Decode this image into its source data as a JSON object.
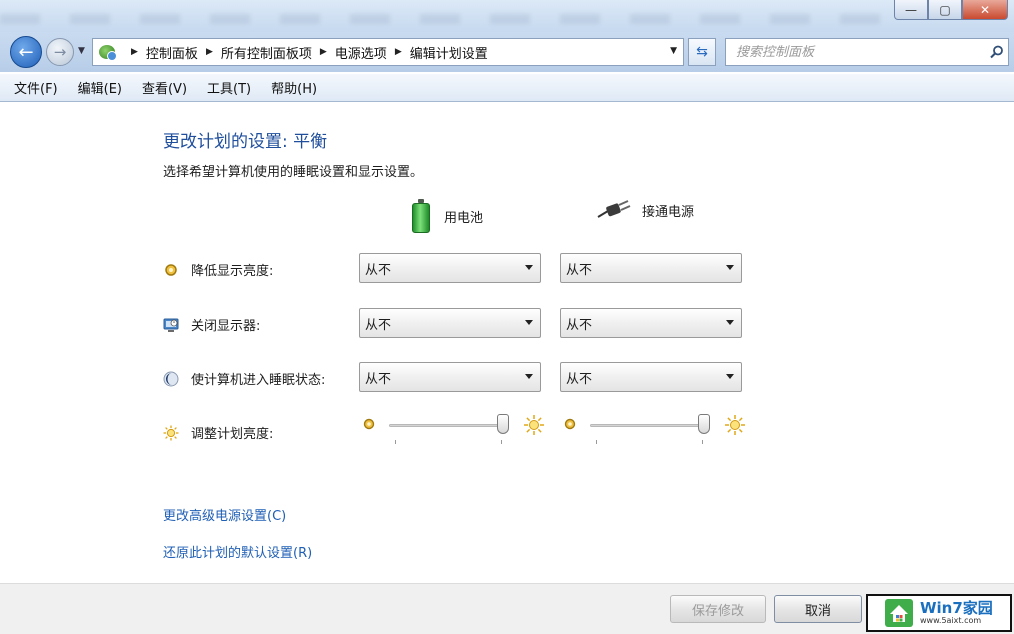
{
  "window": {
    "controls": {
      "minimize": "—",
      "maximize": "▢",
      "close": "✕"
    }
  },
  "address_bar": {
    "breadcrumbs": [
      "控制面板",
      "所有控制面板项",
      "电源选项",
      "编辑计划设置"
    ],
    "search_placeholder": "搜索控制面板"
  },
  "menu": [
    "文件(F)",
    "编辑(E)",
    "查看(V)",
    "工具(T)",
    "帮助(H)"
  ],
  "main": {
    "title": "更改计划的设置: 平衡",
    "subtitle": "选择希望计算机使用的睡眠设置和显示设置。",
    "columns": {
      "battery": "用电池",
      "plugged": "接通电源"
    },
    "rows": [
      {
        "label": "降低显示亮度:",
        "icon": "dim-display-icon",
        "battery": "从不",
        "plugged": "从不"
      },
      {
        "label": "关闭显示器:",
        "icon": "monitor-icon",
        "battery": "从不",
        "plugged": "从不"
      },
      {
        "label": "使计算机进入睡眠状态:",
        "icon": "moon-icon",
        "battery": "从不",
        "plugged": "从不"
      }
    ],
    "brightness": {
      "label": "调整计划亮度:",
      "battery_level": 0.95,
      "plugged_level": 0.95
    },
    "links": {
      "advanced": "更改高级电源设置(C)",
      "restore": "还原此计划的默认设置(R)"
    }
  },
  "footer": {
    "save": "保存修改",
    "cancel": "取消"
  },
  "watermark": {
    "title": "Win7家园",
    "site": "www.5aixt.com"
  },
  "colors": {
    "accent_title": "#1f4e9c",
    "link": "#1f5fb5",
    "battery_green": "#2e9a35"
  }
}
